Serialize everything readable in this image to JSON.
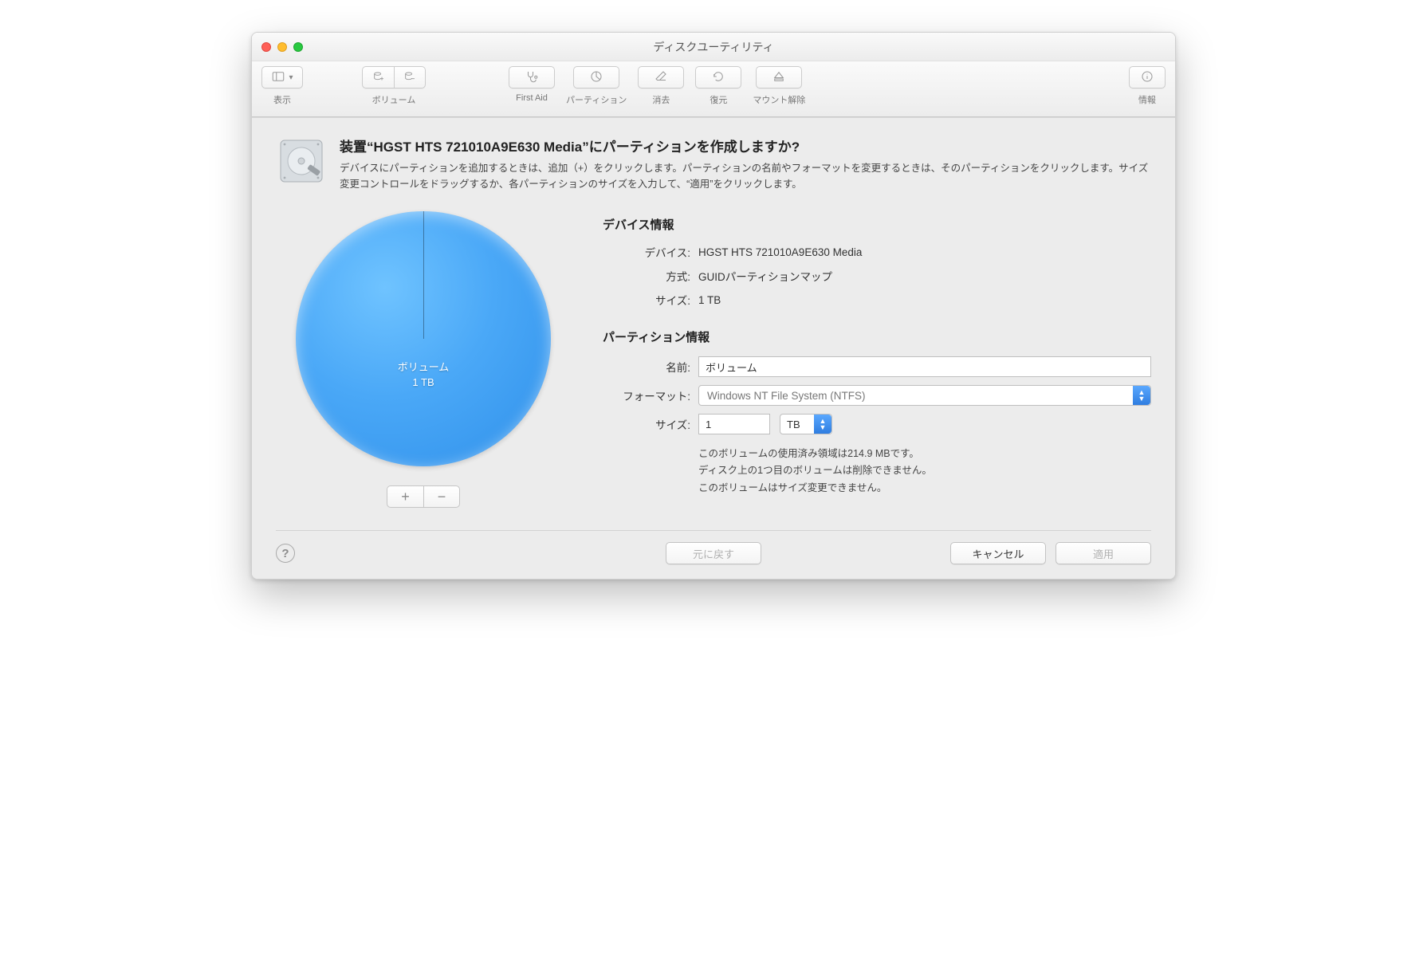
{
  "window": {
    "title": "ディスクユーティリティ"
  },
  "toolbar": {
    "view": "表示",
    "volume": "ボリューム",
    "first_aid": "First Aid",
    "partition": "パーティション",
    "erase": "消去",
    "restore": "復元",
    "unmount": "マウント解除",
    "info": "情報"
  },
  "sheet": {
    "heading": "装置“HGST HTS 721010A9E630 Media”にパーティションを作成しますか?",
    "subtext": "デバイスにパーティションを追加するときは、追加（+）をクリックします。パーティションの名前やフォーマットを変更するときは、そのパーティションをクリックします。サイズ変更コントロールをドラッグするか、各パーティションのサイズを入力して、“適用”をクリックします。"
  },
  "pie": {
    "label_name": "ボリューム",
    "label_size": "1 TB"
  },
  "device_info": {
    "section_title": "デバイス情報",
    "device_label": "デバイス:",
    "device_value": "HGST HTS 721010A9E630 Media",
    "scheme_label": "方式:",
    "scheme_value": "GUIDパーティションマップ",
    "size_label": "サイズ:",
    "size_value": "1 TB"
  },
  "partition_info": {
    "section_title": "パーティション情報",
    "name_label": "名前:",
    "name_value": "ボリューム",
    "format_label": "フォーマット:",
    "format_value": "Windows NT File System (NTFS)",
    "size_label": "サイズ:",
    "size_value": "1",
    "size_unit": "TB",
    "hint1": "このボリュームの使用済み領域は214.9 MBです。",
    "hint2": "ディスク上の1つ目のボリュームは削除できません。",
    "hint3": "このボリュームはサイズ変更できません。"
  },
  "footer": {
    "revert": "元に戻す",
    "cancel": "キャンセル",
    "apply": "適用"
  },
  "chart_data": {
    "type": "pie",
    "title": "",
    "series": [
      {
        "name": "ボリューム",
        "value": 1,
        "unit": "TB",
        "fraction": 1.0,
        "color": "#4aa8f7"
      }
    ]
  }
}
